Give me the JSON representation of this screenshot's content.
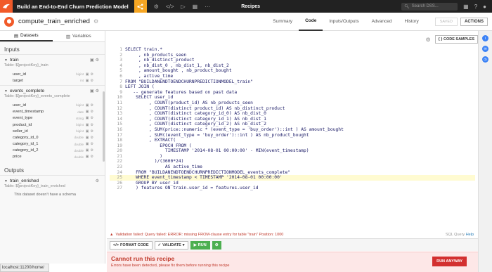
{
  "topnav": {
    "project_title": "Build an End-to-End Churn Prediction Model",
    "section": "Recipes",
    "search_placeholder": "Search DSS..."
  },
  "recipe": {
    "name": "compute_train_enriched",
    "tabs": [
      "Summary",
      "Code",
      "Inputs/Outputs",
      "Advanced",
      "History"
    ],
    "active_tab": "Code",
    "save_label": "SAVED",
    "actions_label": "ACTIONS"
  },
  "left": {
    "tabs": [
      "Datasets",
      "Variables"
    ],
    "inputs_label": "Inputs",
    "outputs_label": "Outputs",
    "inputs": [
      {
        "name": "train",
        "table": "Table: ${projectKey}_train",
        "columns": [
          {
            "name": "user_id",
            "type": "bigint"
          },
          {
            "name": "target",
            "type": "int"
          }
        ]
      },
      {
        "name": "events_complete",
        "table": "Table: ${projectKey}_events_complete",
        "columns": [
          {
            "name": "user_id",
            "type": "bigint"
          },
          {
            "name": "event_timestamp",
            "type": "date"
          },
          {
            "name": "event_type",
            "type": "string"
          },
          {
            "name": "product_id",
            "type": "bigint"
          },
          {
            "name": "seller_id",
            "type": "bigint"
          },
          {
            "name": "category_id_0",
            "type": "double"
          },
          {
            "name": "category_id_1",
            "type": "double"
          },
          {
            "name": "category_id_2",
            "type": "double"
          },
          {
            "name": "price",
            "type": "double"
          }
        ]
      }
    ],
    "output": {
      "name": "train_enriched",
      "table": "Table: ${projectKey}_train_enriched",
      "no_schema": "This dataset doesn't have a schema"
    }
  },
  "editor": {
    "code_samples_label": "CODE SAMPLES",
    "lines": [
      "SELECT train.*",
      "     , nb_products_seen",
      "     , nb_distinct_product",
      "     , nb_dist_0 , nb_dist_1, nb_dist_2",
      "     , amount_bought , nb_product_bought",
      "     , active_time",
      "FROM \"BUILDANENDTOENDCHURNPREDICTIONMODEL_train\"",
      "LEFT JOIN (",
      "   -- generate features based on past data",
      "    SELECT user_id",
      "         , COUNT(product_id) AS nb_products_seen",
      "         , COUNT(distinct product_id) AS nb_distinct_product",
      "         , COUNT(distinct category_id_0) AS nb_dist_0",
      "         , COUNT(distinct category_id_1) AS nb_dist_1",
      "         , COUNT(distinct category_id_2) AS nb_dist_2",
      "         , SUM(price::numeric * (event_type = 'buy_order')::int ) AS amount_bought",
      "         , SUM((event_type = 'buy_order')::int ) AS nb_product_bought",
      "         , EXTRACT(",
      "             EPOCH FROM (",
      "               TIMESTAMP '2014-08-01 00:00:00' - MIN(event_timestamp)",
      "             )",
      "           )/(3600*24)",
      "               AS active_time",
      "    FROM \"BUILDANENDTOENDCHURNPREDICTIONMODEL_events_complete\"",
      "    WHERE event_timestamp < TIMESTAMP '2014-08-01 00:00:00'",
      "    GROUP BY user_id",
      "    ) features ON train.user_id = features.user_id"
    ],
    "highlight_line": 24,
    "error_text": "Validation failed: Query failed: ERROR: missing FROM-clause entry for table \"train\" Position: 1000",
    "sql_help_prefix": "SQL Query",
    "sql_help_link": "Help"
  },
  "toolbar": {
    "format_label": "FORMAT CODE",
    "validate_label": "VALIDATE",
    "run_label": "RUN"
  },
  "banner": {
    "title": "Cannot run this recipe",
    "description": "Errors have been detected, please fix them before running this recipe",
    "run_anyway": "RUN ANYWAY"
  },
  "statusbar": {
    "url": "localhost:11200/home/"
  }
}
